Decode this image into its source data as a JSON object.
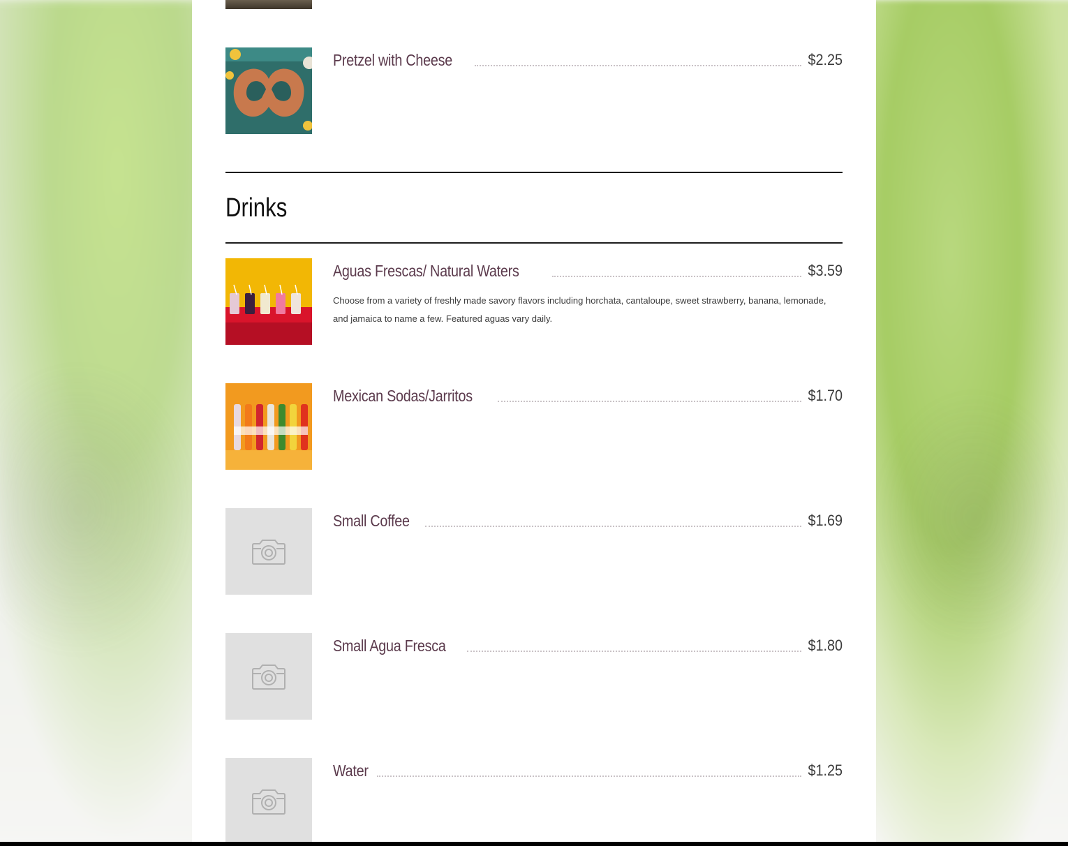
{
  "sections": [
    {
      "title": "Drinks"
    }
  ],
  "items": {
    "pretzel": {
      "name": "Pretzel with Cheese",
      "price": "$2.25",
      "image": "pretzel-photo"
    },
    "aguas": {
      "name": "Aguas Frescas/ Natural Waters",
      "price": "$3.59",
      "description": "Choose from a variety of freshly made savory flavors including horchata, cantaloupe, sweet strawberry, banana, lemonade, and jamaica to name a few. Featured aguas vary daily.",
      "image": "aguas-frescas-photo"
    },
    "sodas": {
      "name": "Mexican Sodas/Jarritos",
      "price": "$1.70",
      "image": "jarritos-photo"
    },
    "coffee": {
      "name": "Small Coffee",
      "price": "$1.69",
      "image": "camera-icon"
    },
    "agua_small": {
      "name": "Small Agua Fresca",
      "price": "$1.80",
      "image": "camera-icon"
    },
    "water": {
      "name": "Water",
      "price": "$1.25",
      "image": "camera-icon"
    }
  },
  "colors": {
    "item_name": "#5b3a4c",
    "price": "#3b3b3b",
    "background_green": "#a6cc64"
  }
}
